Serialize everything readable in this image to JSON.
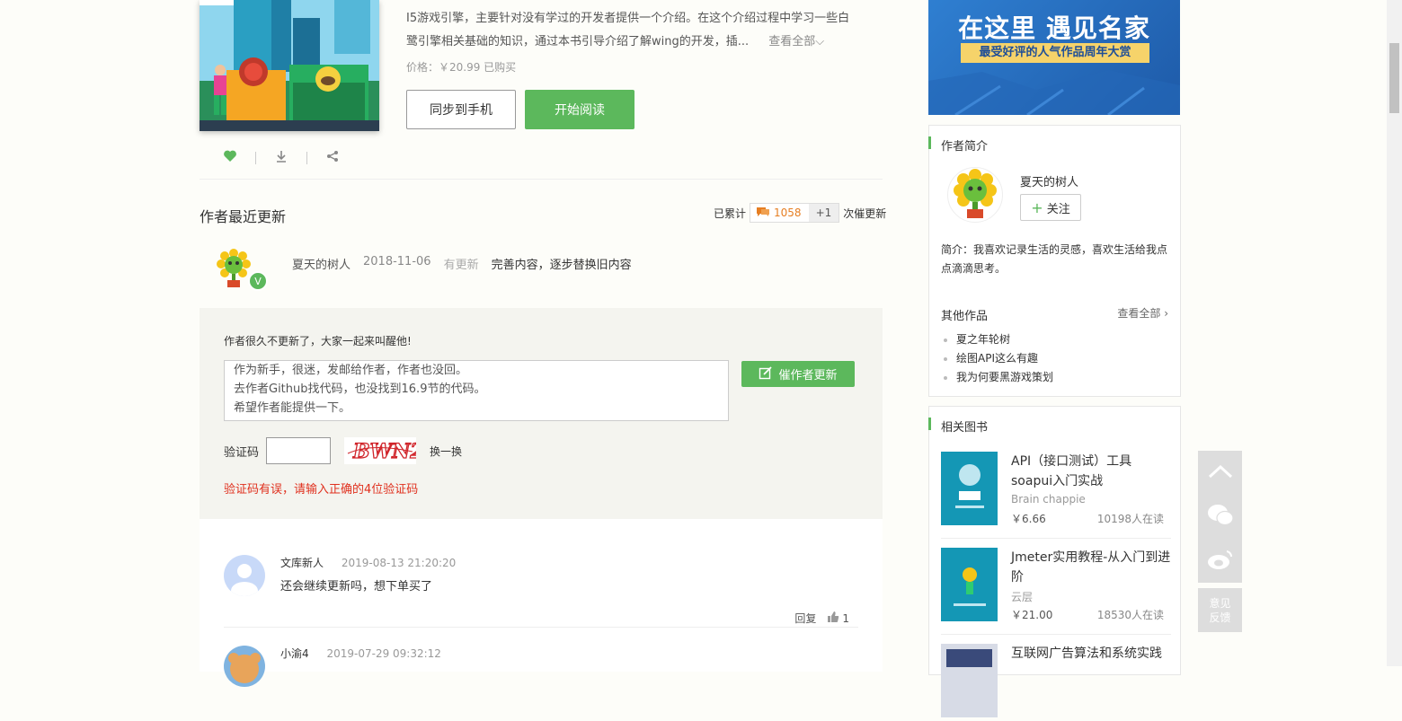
{
  "book": {
    "description_line1": "I5游戏引擎，主要针对没有学过的开发者提供一个介绍。在这个介绍过程中学习一些白",
    "description_line2": "鹭引擎相关基础的知识，通过本书引导介绍了解wing的开发，插...",
    "more_label": "查看全部",
    "price_label": "价格：￥20.99 已购买",
    "sync_button": "同步到手机",
    "read_button": "开始阅读",
    "icons": [
      "heart-icon",
      "download-icon",
      "share-icon"
    ]
  },
  "updates": {
    "title": "作者最近更新",
    "stat_prefix": "已累计",
    "count": "1058",
    "plus_label": "+1",
    "stat_suffix": "次催更新",
    "author": "夏天的树人",
    "date": "2018-11-06",
    "status": "有更新",
    "content": "完善内容，逐步替换旧内容",
    "v_badge": "V"
  },
  "urge": {
    "prompt": "作者很久不更新了，大家一起来叫醒他!",
    "message": "作为新手，很迷，发邮给作者，作者也没回。\n去作者Github找代码，也没找到16.9节的代码。\n希望作者能提供一下。",
    "button": "催作者更新",
    "captcha_label": "验证码",
    "captcha_value": "",
    "captcha_image_text": "BWN2",
    "refresh_label": "换一换",
    "error": "验证码有误，请输入正确的4位验证码"
  },
  "comments": [
    {
      "user": "文库新人",
      "time": "2019-08-13 21:20:20",
      "text": "还会继续更新吗，想下单买了",
      "reply": "回复",
      "likes": "1"
    },
    {
      "user": "小渝4",
      "time": "2019-07-29 09:32:12",
      "text": ""
    }
  ],
  "banner": {
    "headline": "在这里 遇见名家",
    "subline": "最受好评的人气作品周年大赏"
  },
  "author_card": {
    "title": "作者简介",
    "name": "夏天的树人",
    "follow": "关注",
    "intro": "简介：我喜欢记录生活的灵感，喜欢生活给我点点滴滴思考。",
    "other_works_title": "其他作品",
    "view_all": "查看全部",
    "works": [
      "夏之年轮树",
      "绘图API这么有趣",
      "我为何要黑游戏策划"
    ]
  },
  "related": {
    "title": "相关图书",
    "books": [
      {
        "title": "API（接口测试）工具soapui入门实战",
        "author": "Brain chappie",
        "price": "￥6.66",
        "readers": "10198人在读"
      },
      {
        "title": "Jmeter实用教程-从入门到进阶",
        "author": "云层",
        "price": "￥21.00",
        "readers": "18530人在读"
      },
      {
        "title": "互联网广告算法和系统实践",
        "author": "",
        "price": "",
        "readers": ""
      }
    ]
  },
  "side_float": {
    "feedback": "意见反馈"
  },
  "colors": {
    "accent": "#5cb85c",
    "error": "#e0301e",
    "count": "#e67e22"
  }
}
